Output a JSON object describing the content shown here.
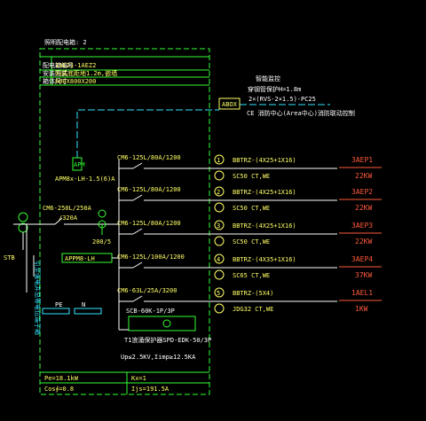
{
  "panel": {
    "title": "照明配电箱: 2",
    "rows": [
      {
        "label": "配电箱编号",
        "value": "1AEZ1-1AEZ2"
      },
      {
        "label": "安装方式",
        "value": "明装底距地1.2m,嵌墙"
      },
      {
        "label": "箱体尺寸",
        "value": "800X800X200"
      }
    ],
    "footer": [
      {
        "left": "Pe=18.1kW",
        "right": "Kx=1"
      },
      {
        "left": "Cos∮=0.8",
        "right": "Ijs=191.5A"
      }
    ]
  },
  "incoming": {
    "main_breaker": "CM6-250L/250A",
    "setting": "/320A",
    "meter_label": "APM",
    "meter_model": "APM8x-LH-1.5(6)A",
    "ct": "200/5",
    "terminal_label": "APPM8-LH",
    "grounding_label": "引至强电井总等电位端子箱",
    "stb_label": "STB",
    "busbar_pe": "PE",
    "busbar_n": "N"
  },
  "comm": {
    "title": "智能监控",
    "line1": "穿钢管保护H=1.8m",
    "line2": "2×(RVS-2×1.5)-PC25",
    "box": "ABOX",
    "line3": "CE 消防中心(Area中心)消防联动控制"
  },
  "circuits": [
    {
      "breaker": "CM6-125L/80A/1200",
      "num": "1",
      "cable": "BBTRZ-(4X25+1X16)",
      "note": "SC50 CT,WE",
      "tag": "3AEP1",
      "kw": "22KW"
    },
    {
      "breaker": "CM6-125L/80A/1200",
      "num": "2",
      "cable": "BBTRZ-(4X25+1X16)",
      "note": "SC50 CT,WE",
      "tag": "3AEP2",
      "kw": "22KW"
    },
    {
      "breaker": "CM6-125L/80A/1200",
      "num": "3",
      "cable": "BBTRZ-(4X25+1X16)",
      "note": "SC50 CT,WE",
      "tag": "3AEP3",
      "kw": "22KW"
    },
    {
      "breaker": "CM6-125L/100A/1200",
      "num": "4",
      "cable": "BBTRZ-(4X35+1X16)",
      "note": "SC65 CT,WE",
      "tag": "3AEP4",
      "kw": "37KW"
    },
    {
      "breaker": "CM6-63L/25A/3200",
      "num": "5",
      "cable": "BBTRZ-(5X4)",
      "note": "JDG32 CT,WE",
      "tag": "1AEL1",
      "kw": "1KW"
    }
  ],
  "spd": {
    "breaker": "SCB-60K-1P/3P",
    "model": "T1浪涌保护器SPD-EDK-50/3P",
    "spec": "Up≤2.5KV,Iimp≥12.5KA"
  }
}
